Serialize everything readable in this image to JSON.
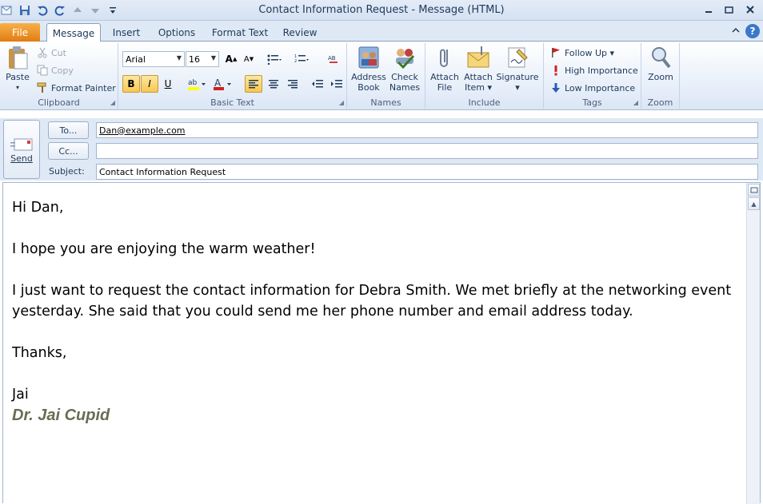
{
  "window": {
    "title": "Contact Information Request  -  Message (HTML)"
  },
  "tabs": {
    "file": "File",
    "items": [
      "Message",
      "Insert",
      "Options",
      "Format Text",
      "Review"
    ]
  },
  "ribbon": {
    "clipboard": {
      "label": "Clipboard",
      "paste": "Paste",
      "cut": "Cut",
      "copy": "Copy",
      "format_painter": "Format Painter"
    },
    "basic_text": {
      "label": "Basic Text",
      "font_name": "Arial",
      "font_size": "16",
      "bold": "B",
      "italic": "I",
      "underline": "U"
    },
    "names": {
      "label": "Names",
      "address_book_1": "Address",
      "address_book_2": "Book",
      "check_names_1": "Check",
      "check_names_2": "Names"
    },
    "include": {
      "label": "Include",
      "attach_file_1": "Attach",
      "attach_file_2": "File",
      "attach_item_1": "Attach",
      "attach_item_2": "Item ▾",
      "signature_1": "Signature",
      "signature_2": "▾"
    },
    "tags": {
      "label": "Tags",
      "follow_up": "Follow Up ▾",
      "high_importance": "High Importance",
      "low_importance": "Low Importance"
    },
    "zoom": {
      "label": "Zoom",
      "zoom_button": "Zoom"
    }
  },
  "compose": {
    "send": "Send",
    "to_button": "To...",
    "cc_button": "Cc...",
    "subject_label": "Subject:",
    "to_value": "Dan@example.com",
    "cc_value": "",
    "subject_value": "Contact Information Request"
  },
  "body": {
    "greeting": "Hi Dan,",
    "line1": "I hope you are enjoying the warm weather!",
    "line2": "I just want to request the contact information for Debra Smith.  We met briefly at the networking event yesterday.  She said that you could send me her phone number and email address today.",
    "closing": "Thanks,",
    "name": "Jai",
    "signature": "Dr. Jai Cupid"
  },
  "colors": {
    "file_tab": "#e07d12",
    "ribbon_text": "#1e395b",
    "signature": "#6b6b55"
  }
}
